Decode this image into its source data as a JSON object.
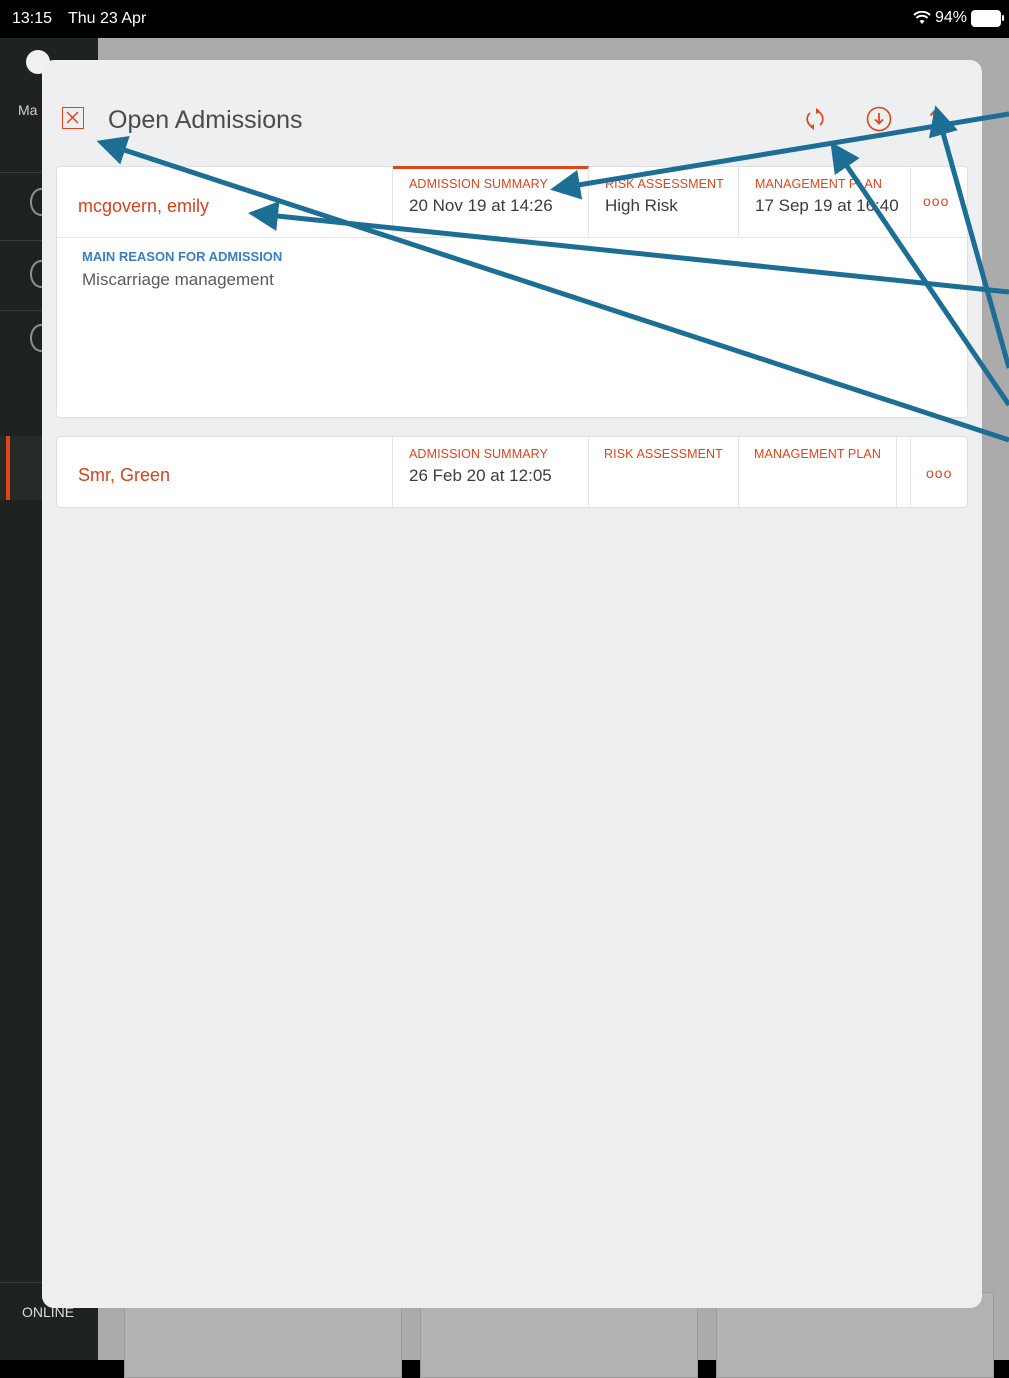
{
  "status_bar": {
    "time": "13:15",
    "date": "Thu 23 Apr",
    "battery": "94%"
  },
  "sidebar": {
    "app_label": "Ma",
    "online_label": "ONLINE"
  },
  "modal": {
    "title": "Open Admissions",
    "header_icons": [
      "sync-icon",
      "download-icon",
      "upload-icon"
    ]
  },
  "admissions": [
    {
      "patient": "mcgovern, emily",
      "summary_label": "ADMISSION SUMMARY",
      "summary_value": "20 Nov 19 at 14:26",
      "risk_label": "RISK ASSESSMENT",
      "risk_value": "High Risk",
      "plan_label": "MANAGEMENT PLAN",
      "plan_value": "17 Sep 19 at 16:40",
      "more": "ooo",
      "reason_label": "MAIN REASON FOR ADMISSION",
      "reason_value": "Miscarriage management"
    },
    {
      "patient": "Smr, Green",
      "summary_label": "ADMISSION SUMMARY",
      "summary_value": "26 Feb 20 at 12:05",
      "risk_label": "RISK ASSESSMENT",
      "plan_label": "MANAGEMENT PLAN",
      "more": "ooo"
    }
  ],
  "colors": {
    "accent": "#e0451b",
    "reason_blue": "#3a7fbf",
    "annotation_arrow": "#1d6e94"
  }
}
